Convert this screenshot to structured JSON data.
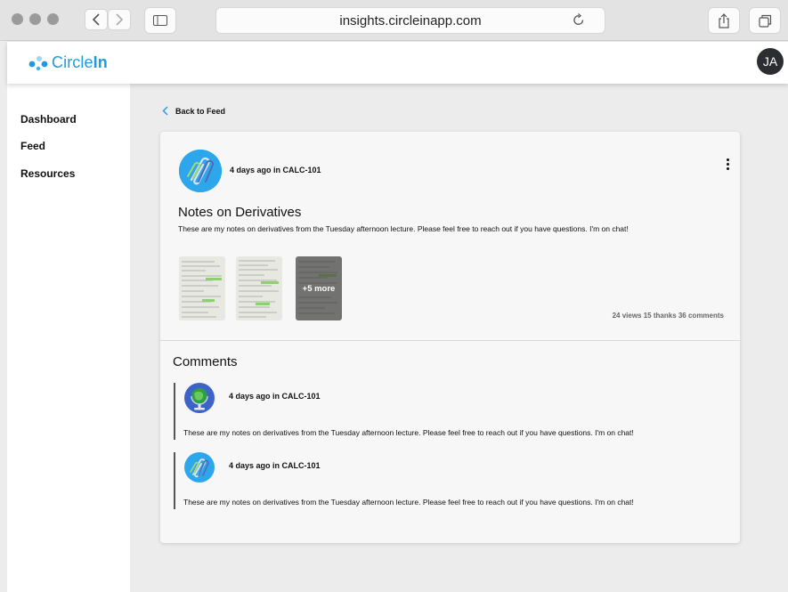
{
  "browser": {
    "url": "insights.circleinapp.com"
  },
  "app": {
    "logo_text_plain": "Circle",
    "logo_text_bold": "In",
    "user_initials": "JA"
  },
  "sidebar": {
    "items": [
      {
        "label": "Dashboard"
      },
      {
        "label": "Feed"
      },
      {
        "label": "Resources"
      }
    ]
  },
  "back_link": "Back to Feed",
  "post": {
    "meta": "4 days ago in CALC-101",
    "title": "Notes on Derivatives",
    "body": "These are my notes on derivatives from the Tuesday afternoon lecture. Please feel free to reach out if you have questions. I'm on chat!",
    "more_label": "+5 more",
    "stats": "24 views 15 thanks 36 comments"
  },
  "comments": {
    "title": "Comments",
    "items": [
      {
        "meta": "4 days ago in CALC-101",
        "text": "These are my notes on derivatives from the Tuesday afternoon lecture. Please feel free to reach out if you have questions. I'm on chat!",
        "avatar": "globe-icon"
      },
      {
        "meta": "4 days ago in CALC-101",
        "text": "These are my notes on derivatives from the Tuesday afternoon lecture. Please feel free to reach out if you have questions. I'm on chat!",
        "avatar": "paperclip-icon"
      }
    ]
  },
  "colors": {
    "brand": "#1e9be0",
    "avatar_blue": "#2ea6eb"
  }
}
